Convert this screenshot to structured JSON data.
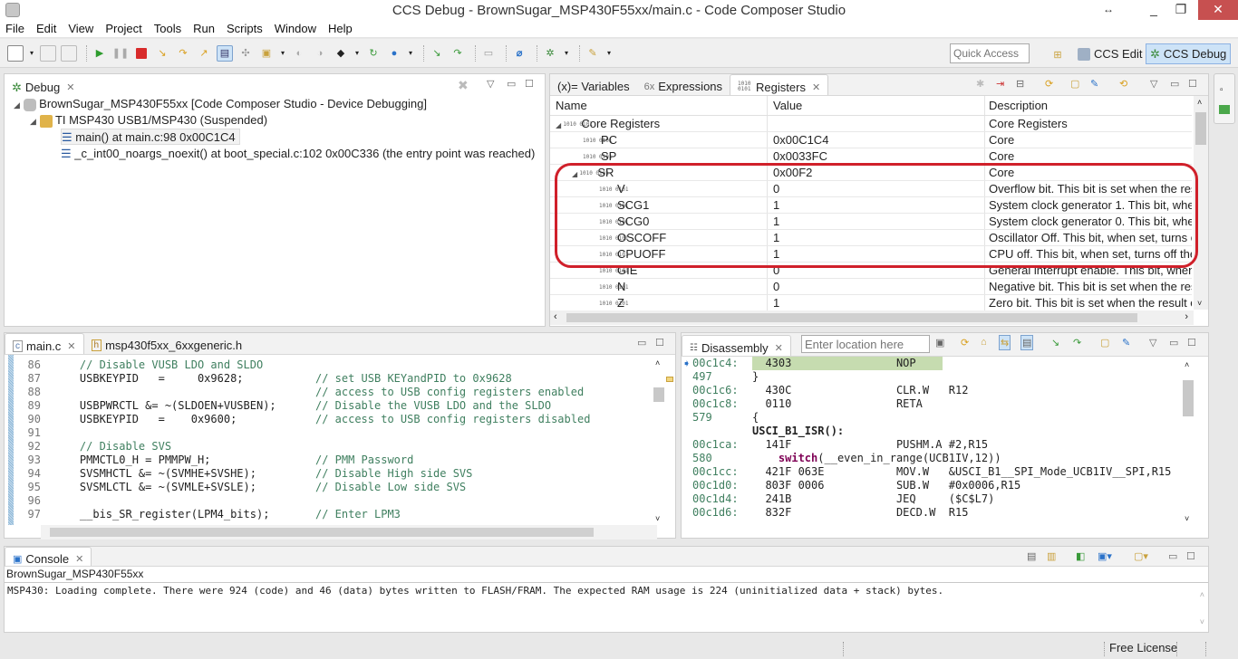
{
  "window": {
    "title": "CCS Debug - BrownSugar_MSP430F55xx/main.c - Code Composer Studio",
    "minimize": "_",
    "maximize": "❐",
    "close": "✕",
    "resize": "↔"
  },
  "menu": [
    "File",
    "Edit",
    "View",
    "Project",
    "Tools",
    "Run",
    "Scripts",
    "Window",
    "Help"
  ],
  "quick_access": {
    "placeholder": "Quick Access"
  },
  "perspectives": [
    {
      "label": "CCS Edit",
      "selected": false
    },
    {
      "label": "CCS Debug",
      "selected": true
    }
  ],
  "debug": {
    "tab_label": "Debug",
    "tree": [
      {
        "label": "BrownSugar_MSP430F55xx [Code Composer Studio - Device Debugging]",
        "level": 0
      },
      {
        "label": "TI MSP430 USB1/MSP430 (Suspended)",
        "level": 1
      },
      {
        "label": "main() at main.c:98 0x00C1C4",
        "level": 2,
        "selected": true
      },
      {
        "label": "_c_int00_noargs_noexit() at boot_special.c:102 0x00C336  (the entry point was reached)",
        "level": 2
      }
    ]
  },
  "registers": {
    "tabs": [
      {
        "label": "(x)= Variables",
        "selected": false
      },
      {
        "label": "Expressions",
        "selected": false
      },
      {
        "label": "Registers",
        "selected": true
      }
    ],
    "columns": [
      "Name",
      "Value",
      "Description"
    ],
    "rows": [
      {
        "name": "Core Registers",
        "value": "",
        "desc": "Core Registers",
        "level": 0,
        "expanded": true
      },
      {
        "name": "PC",
        "value": "0x00C1C4",
        "desc": "Core",
        "level": 1
      },
      {
        "name": "SP",
        "value": "0x0033FC",
        "desc": "Core",
        "level": 1
      },
      {
        "name": "SR",
        "value": "0x00F2",
        "desc": "Core",
        "level": 1,
        "expanded": true
      },
      {
        "name": "V",
        "value": "0",
        "desc": "Overflow bit. This bit is set when the res.",
        "level": 2
      },
      {
        "name": "SCG1",
        "value": "1",
        "desc": "System clock generator 1. This bit, wher",
        "level": 2
      },
      {
        "name": "SCG0",
        "value": "1",
        "desc": "System clock generator 0. This bit, wher",
        "level": 2
      },
      {
        "name": "OSCOFF",
        "value": "1",
        "desc": "Oscillator Off. This bit, when set, turns of",
        "level": 2
      },
      {
        "name": "CPUOFF",
        "value": "1",
        "desc": "CPU off. This bit, when set, turns off the",
        "level": 2
      },
      {
        "name": "GIE",
        "value": "0",
        "desc": "General interrupt enable. This bit, when",
        "level": 2
      },
      {
        "name": "N",
        "value": "0",
        "desc": "Negative bit. This bit is set when the res.",
        "level": 2
      },
      {
        "name": "Z",
        "value": "1",
        "desc": "Zero bit. This bit is set when the result of",
        "level": 2
      }
    ],
    "highlight_color": "#d0202a"
  },
  "editor": {
    "tabs": [
      {
        "label": "main.c",
        "selected": true
      },
      {
        "label": "msp430f5xx_6xxgeneric.h",
        "selected": false
      }
    ],
    "lines": [
      {
        "n": "86",
        "code": "    ",
        "comment": "// Disable VUSB LDO and SLDO"
      },
      {
        "n": "87",
        "code": "    USBKEYPID   =     0x9628;           ",
        "comment": "// set USB KEYandPID to 0x9628"
      },
      {
        "n": "88",
        "code": "                                        ",
        "comment": "// access to USB config registers enabled"
      },
      {
        "n": "89",
        "code": "    USBPWRCTL &= ~(SLDOEN+VUSBEN);      ",
        "comment": "// Disable the VUSB LDO and the SLDO"
      },
      {
        "n": "90",
        "code": "    USBKEYPID   =    0x9600;            ",
        "comment": "// access to USB config registers disabled"
      },
      {
        "n": "91",
        "code": "",
        "comment": ""
      },
      {
        "n": "92",
        "code": "    ",
        "comment": "// Disable SVS"
      },
      {
        "n": "93",
        "code": "    PMMCTL0_H = PMMPW_H;                ",
        "comment": "// PMM Password"
      },
      {
        "n": "94",
        "code": "    SVSMHCTL &= ~(SVMHE+SVSHE);         ",
        "comment": "// Disable High side SVS"
      },
      {
        "n": "95",
        "code": "    SVSMLCTL &= ~(SVMLE+SVSLE);         ",
        "comment": "// Disable Low side SVS"
      },
      {
        "n": "96",
        "code": "",
        "comment": ""
      },
      {
        "n": "97",
        "code": "    __bis_SR_register(LPM4_bits);       ",
        "comment": "// Enter LPM3"
      }
    ]
  },
  "disassembly": {
    "tab_label": "Disassembly",
    "location_placeholder": "Enter location here",
    "lines": [
      {
        "addr": "00c1c4:",
        "text": "  4303                NOP",
        "current": true
      },
      {
        "addr": "497",
        "text": "}"
      },
      {
        "addr": "00c1c6:",
        "text": "  430C                CLR.W   R12"
      },
      {
        "addr": "00c1c8:",
        "text": "  0110                RETA"
      },
      {
        "addr": "579",
        "text": "{"
      },
      {
        "addr": "",
        "text": "USCI_B1_ISR():",
        "bold": true
      },
      {
        "addr": "00c1ca:",
        "text": "  141F                PUSHM.A #2,R15"
      },
      {
        "addr": "580",
        "text": "    switch(__even_in_range(UCB1IV,12))",
        "keyword": "switch"
      },
      {
        "addr": "00c1cc:",
        "text": "  421F 063E           MOV.W   &USCI_B1__SPI_Mode_UCB1IV__SPI,R15"
      },
      {
        "addr": "00c1d0:",
        "text": "  803F 0006           SUB.W   #0x0006,R15"
      },
      {
        "addr": "00c1d4:",
        "text": "  241B                JEQ     ($C$L7)"
      },
      {
        "addr": "00c1d6:",
        "text": "  832F                DECD.W  R15"
      }
    ]
  },
  "console": {
    "tab_label": "Console",
    "session": "BrownSugar_MSP430F55xx",
    "output": "MSP430: Loading complete. There were 924 (code) and 46 (data) bytes written to FLASH/FRAM. The expected RAM usage is 224 (uninitialized data + stack) bytes."
  },
  "status": {
    "license": "Free License"
  }
}
